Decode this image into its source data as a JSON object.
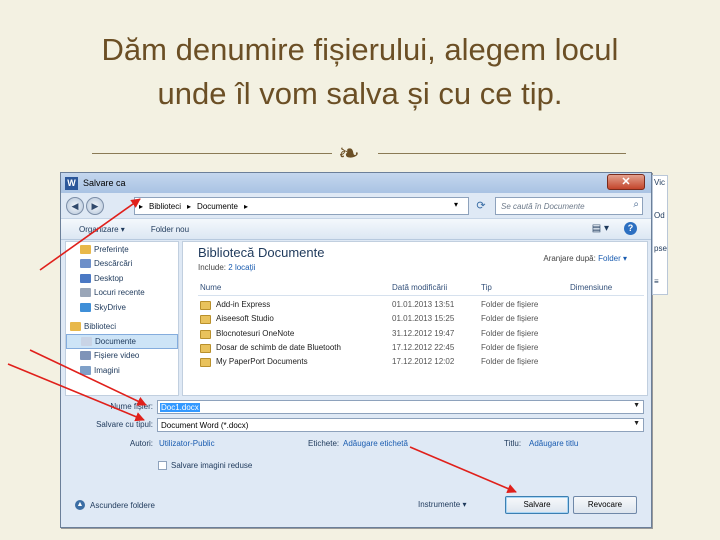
{
  "slide": {
    "title_line1": "Dăm denumire fișierului, alegem locul",
    "title_line2": "unde îl vom salva și cu ce tip."
  },
  "dialog": {
    "title": "Salvare ca",
    "close_label": "✕",
    "address_crumbs": [
      "Biblioteci",
      "Documente"
    ],
    "search_placeholder": "Se caută în Documente",
    "toolbar": {
      "organize": "Organizare ▾",
      "new_folder": "Folder nou"
    },
    "nav_items": [
      {
        "label": "Preferințe",
        "color": "#e8b84a",
        "section": false
      },
      {
        "label": "Descărcări",
        "color": "#6d8fc9",
        "section": false
      },
      {
        "label": "Desktop",
        "color": "#4b79c4",
        "section": false
      },
      {
        "label": "Locuri recente",
        "color": "#9aa6b8",
        "section": false
      },
      {
        "label": "SkyDrive",
        "color": "#3f8fd8",
        "section": false
      },
      {
        "label": "Biblioteci",
        "color": "#e8b84a",
        "section": true
      },
      {
        "label": "Documente",
        "color": "#c9d4e6",
        "section": false,
        "selected": true
      },
      {
        "label": "Fișiere video",
        "color": "#7f93b8",
        "section": false
      },
      {
        "label": "Imagini",
        "color": "#7fa0c8",
        "section": false
      }
    ],
    "library": {
      "title": "Bibliotecă Documente",
      "includes_label": "Include:",
      "includes_link": "2 locații",
      "arrange_label": "Aranjare după:",
      "arrange_value": "Folder ▾"
    },
    "columns": [
      "Nume",
      "Dată modificării",
      "Tip",
      "Dimensiune"
    ],
    "files": [
      {
        "name": "Add-in Express",
        "date": "01.01.2013 13:51",
        "type": "Folder de fișiere"
      },
      {
        "name": "Aiseesoft Studio",
        "date": "01.01.2013 15:25",
        "type": "Folder de fișiere"
      },
      {
        "name": "Blocnotesuri OneNote",
        "date": "31.12.2012 19:47",
        "type": "Folder de fișiere"
      },
      {
        "name": "Dosar de schimb de date Bluetooth",
        "date": "17.12.2012 22:45",
        "type": "Folder de fișiere"
      },
      {
        "name": "My PaperPort Documents",
        "date": "17.12.2012 12:02",
        "type": "Folder de fișiere"
      }
    ],
    "fields": {
      "filename_label": "Nume fișier:",
      "filename_value": "Doc1.docx",
      "filetype_label": "Salvare cu tipul:",
      "filetype_value": "Document Word (*.docx)",
      "authors_label": "Autori:",
      "authors_value": "Utilizator-Public",
      "tags_label": "Etichete:",
      "tags_value": "Adăugare etichetă",
      "title_label": "Titlu:",
      "title_value": "Adăugare titlu",
      "thumbnail_label": "Salvare imagini reduse"
    },
    "footer": {
      "hide_folders": "Ascundere foldere",
      "tools": "Instrumente ▾",
      "save": "Salvare",
      "cancel": "Revocare"
    }
  },
  "behind_window": [
    "Vic",
    "Od",
    "pse",
    "≡"
  ],
  "arrow_color": "#e0201b"
}
